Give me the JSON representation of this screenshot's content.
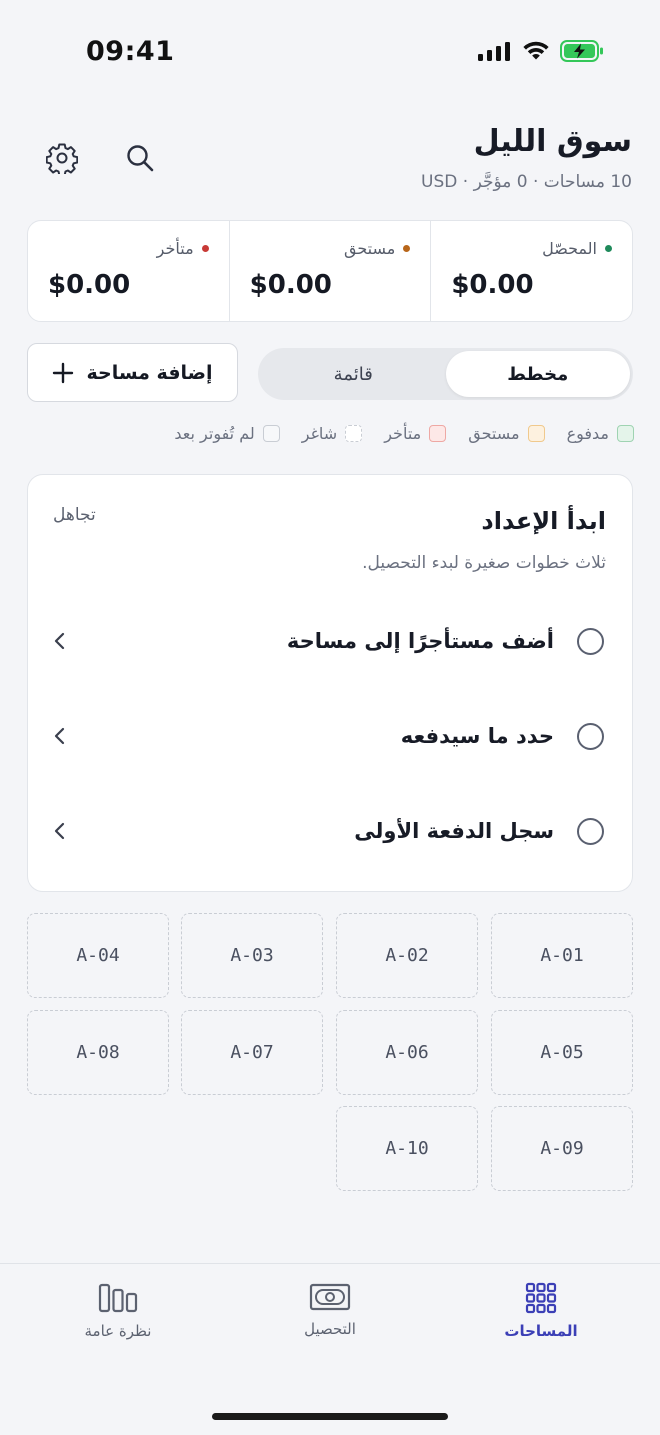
{
  "status_bar": {
    "time": "09:41"
  },
  "header": {
    "title": "سوق الليل",
    "subtitle": "10 مساحات · 0 مؤجَّر · USD"
  },
  "summary": [
    {
      "label": "المحصّل",
      "value": "$0.00",
      "dot_color": "#1f8a5b"
    },
    {
      "label": "مستحق",
      "value": "$0.00",
      "dot_color": "#b8661a"
    },
    {
      "label": "متأخر",
      "value": "$0.00",
      "dot_color": "#c83a36"
    }
  ],
  "view_toggle": {
    "options": [
      "مخطط",
      "قائمة"
    ],
    "selected": "مخطط"
  },
  "add_button": {
    "label": "إضافة مساحة"
  },
  "legend": [
    {
      "label": "مدفوع",
      "fill": "#e4f4ea",
      "border": "#9fd3b2"
    },
    {
      "label": "مستحق",
      "fill": "#fdf1df",
      "border": "#f0c98d"
    },
    {
      "label": "متأخر",
      "fill": "#fde8e7",
      "border": "#eea8a4"
    },
    {
      "label": "شاغر",
      "fill": "#ffffff",
      "border": "#c9cdd4"
    },
    {
      "label": "لم تُفوتر بعد",
      "fill": "#f7f8fa",
      "border": "#c9cdd4"
    }
  ],
  "setup": {
    "title": "ابدأ الإعداد",
    "dismiss": "تجاهل",
    "description": "ثلاث خطوات صغيرة لبدء التحصيل.",
    "steps": [
      {
        "label": "أضف مستأجرًا إلى مساحة"
      },
      {
        "label": "حدد ما سيدفعه"
      },
      {
        "label": "سجل الدفعة الأولى"
      }
    ]
  },
  "stalls": [
    "A-01",
    "A-02",
    "A-03",
    "A-04",
    "A-05",
    "A-06",
    "A-07",
    "A-08",
    "A-09",
    "A-10"
  ],
  "tabs": [
    {
      "label": "المساحات",
      "icon": "grid-icon",
      "active": true
    },
    {
      "label": "التحصيل",
      "icon": "banknote-icon",
      "active": false
    },
    {
      "label": "نظرة عامة",
      "icon": "columns-icon",
      "active": false
    }
  ],
  "colors": {
    "accent": "#3b3fb6",
    "battery": "#34c759"
  }
}
